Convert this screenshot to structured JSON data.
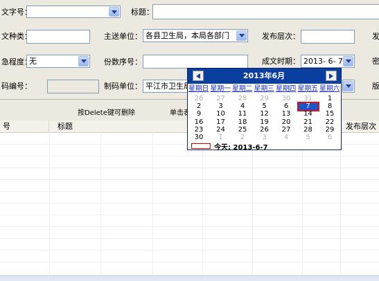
{
  "form": {
    "doc_no_label": "文字号：",
    "title_label": "标题：",
    "doc_type_label": "文种类：",
    "main_unit_label": "主送单位：",
    "main_unit_value": "各县卫生局，本局各部门",
    "publish_level_label": "发布层次：",
    "publish_cut_label": "发",
    "urgency_label": "急程度：",
    "urgency_value": "无",
    "copy_no_label": "份数序号：",
    "date_label": "成文时期：",
    "date_value": "2013- 6- 7",
    "secret_cut_label": "密",
    "code_label": "码编号：",
    "issue_unit_label": "制码单位：",
    "issue_unit_value": "平江市卫生局",
    "version_cut_label": "版"
  },
  "actions": {
    "delete_hint": "按Delete键可删除",
    "click_hint": "单击表"
  },
  "grid": {
    "columns": [
      "号",
      "标题",
      "发布层次"
    ]
  },
  "calendar": {
    "title": "2013年6月",
    "weekdays": [
      "星期日",
      "星期一",
      "星期二",
      "星期三",
      "星期四",
      "星期五",
      "星期六"
    ],
    "weeks": [
      [
        {
          "d": "26",
          "o": true
        },
        {
          "d": "27",
          "o": true
        },
        {
          "d": "28",
          "o": true
        },
        {
          "d": "29",
          "o": true
        },
        {
          "d": "30",
          "o": true
        },
        {
          "d": "31",
          "o": true
        },
        {
          "d": "1",
          "o": false
        }
      ],
      [
        {
          "d": "2",
          "o": false
        },
        {
          "d": "3",
          "o": false
        },
        {
          "d": "4",
          "o": false
        },
        {
          "d": "5",
          "o": false
        },
        {
          "d": "6",
          "o": false
        },
        {
          "d": "7",
          "o": false,
          "sel": true
        },
        {
          "d": "8",
          "o": false
        }
      ],
      [
        {
          "d": "9",
          "o": false
        },
        {
          "d": "10",
          "o": false
        },
        {
          "d": "11",
          "o": false
        },
        {
          "d": "12",
          "o": false
        },
        {
          "d": "13",
          "o": false
        },
        {
          "d": "14",
          "o": false
        },
        {
          "d": "15",
          "o": false
        }
      ],
      [
        {
          "d": "16",
          "o": false
        },
        {
          "d": "17",
          "o": false
        },
        {
          "d": "18",
          "o": false
        },
        {
          "d": "19",
          "o": false
        },
        {
          "d": "20",
          "o": false
        },
        {
          "d": "21",
          "o": false
        },
        {
          "d": "22",
          "o": false
        }
      ],
      [
        {
          "d": "23",
          "o": false
        },
        {
          "d": "24",
          "o": false
        },
        {
          "d": "25",
          "o": false
        },
        {
          "d": "26",
          "o": false
        },
        {
          "d": "27",
          "o": false
        },
        {
          "d": "28",
          "o": false
        },
        {
          "d": "29",
          "o": false
        }
      ],
      [
        {
          "d": "30",
          "o": false
        },
        {
          "d": "1",
          "o": true
        },
        {
          "d": "2",
          "o": true
        },
        {
          "d": "3",
          "o": true
        },
        {
          "d": "4",
          "o": true
        },
        {
          "d": "5",
          "o": true
        },
        {
          "d": "6",
          "o": true
        }
      ]
    ],
    "today_text": "今天: 2013-6-7",
    "colors": {
      "header": "#0a3fa0",
      "selected": "#1c55c8",
      "weekday_link": "#1e2fd0"
    }
  }
}
